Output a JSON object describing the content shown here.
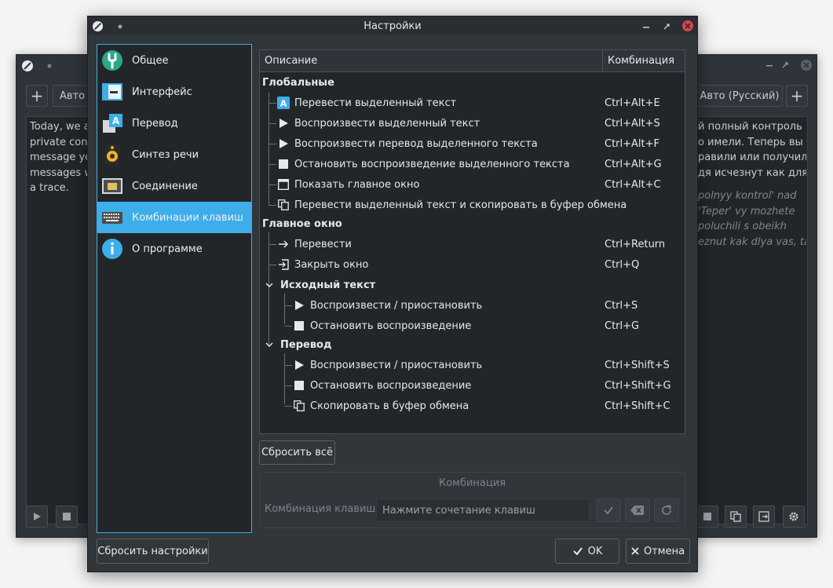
{
  "background_window": {
    "left_text": "Today, we ar\nprivate conv\nmessage you\nmessages wi\na trace.",
    "right_text": "й полный контроль\nо имели. Теперь вы\nравили или получили\nдя исчезнут как для",
    "right_translit": "polnyy kontrol' nad\n'Teper' vy mozhete\npoluchili s obeikh\neznut kak dlya vas, tak",
    "source_lang_button": "Авто (",
    "target_lang_button": "Авто (Русский)",
    "add_label": "+"
  },
  "dialog": {
    "title": "Настройки",
    "sidebar": {
      "items": [
        {
          "label": "Общее",
          "icon": "general-settings-icon"
        },
        {
          "label": "Интерфейс",
          "icon": "interface-icon"
        },
        {
          "label": "Перевод",
          "icon": "translation-icon"
        },
        {
          "label": "Синтез речи",
          "icon": "speaker-icon"
        },
        {
          "label": "Соединение",
          "icon": "network-icon"
        },
        {
          "label": "Комбинации клавиш",
          "icon": "keyboard-icon"
        },
        {
          "label": "О программе",
          "icon": "info-icon"
        }
      ],
      "active_index": 5
    },
    "shortcuts": {
      "headers": {
        "description": "Описание",
        "combination": "Комбинация"
      },
      "groups": {
        "global": "Глобальные",
        "main_window": "Главное окно",
        "source_text": "Исходный текст",
        "translation": "Перевод"
      },
      "global_rows": [
        {
          "label": "Перевести выделенный текст",
          "combo": "Ctrl+Alt+E",
          "icon": "translate-icon"
        },
        {
          "label": "Воспроизвести выделенный текст",
          "combo": "Ctrl+Alt+S",
          "icon": "play-icon"
        },
        {
          "label": "Воспроизвести перевод выделенного текста",
          "combo": "Ctrl+Alt+F",
          "icon": "play-icon"
        },
        {
          "label": "Остановить воспроизведение выделенного текста",
          "combo": "Ctrl+Alt+G",
          "icon": "stop-icon"
        },
        {
          "label": "Показать главное окно",
          "combo": "Ctrl+Alt+C",
          "icon": "window-icon"
        },
        {
          "label": "Перевести выделенный текст и скопировать в буфер обмена",
          "combo": "",
          "icon": "copy-icon"
        }
      ],
      "main_rows": [
        {
          "label": "Перевести",
          "combo": "Ctrl+Return",
          "icon": "arrow-right-icon"
        },
        {
          "label": "Закрыть окно",
          "combo": "Ctrl+Q",
          "icon": "exit-icon"
        }
      ],
      "source_rows": [
        {
          "label": "Воспроизвести / приостановить",
          "combo": "Ctrl+S",
          "icon": "play-icon"
        },
        {
          "label": "Остановить воспроизведение",
          "combo": "Ctrl+G",
          "icon": "stop-icon"
        }
      ],
      "translation_rows": [
        {
          "label": "Воспроизвести / приостановить",
          "combo": "Ctrl+Shift+S",
          "icon": "play-icon"
        },
        {
          "label": "Остановить воспроизведение",
          "combo": "Ctrl+Shift+G",
          "icon": "stop-icon"
        },
        {
          "label": "Скопировать в буфер обмена",
          "combo": "Ctrl+Shift+C",
          "icon": "copy-icon"
        }
      ]
    },
    "reset_all_label": "Сбросить всё",
    "combo_box": {
      "title": "Комбинация",
      "label": "Комбинация клавиш:",
      "placeholder": "Нажмите сочетание клавиш"
    },
    "reset_settings_label": "Сбросить настройки",
    "ok_label": "OK",
    "cancel_label": "Отмена"
  },
  "colors": {
    "accent": "#3daee9",
    "close_button": "#da4453"
  }
}
